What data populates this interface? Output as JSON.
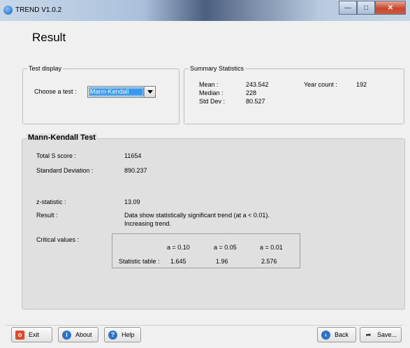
{
  "window": {
    "title": "TREND V1.0.2"
  },
  "page": {
    "title": "Result"
  },
  "test_display": {
    "legend": "Test display",
    "choose_label": "Choose a test :",
    "selected_test": "Mann-Kendall"
  },
  "summary": {
    "legend": "Summary Statistics",
    "mean_label": "Mean :",
    "mean_value": "243.542",
    "median_label": "Median :",
    "median_value": "228",
    "std_label": "Std Dev :",
    "std_value": "80.527",
    "year_count_label": "Year count :",
    "year_count_value": "192"
  },
  "mann_kendall": {
    "legend": "Mann-Kendall Test",
    "s_label": "Total S score :",
    "s_value": "11654",
    "sd_label": "Standard Deviation :",
    "sd_value": "890.237",
    "z_label": "z-statistic :",
    "z_value": "13.09",
    "result_label": "Result :",
    "result_line1": "Data show statistically significant trend (at a < 0.01).",
    "result_line2": "Increasing trend.",
    "critical_label": "Critical values :",
    "critical_headers": [
      "a = 0.10",
      "a = 0.05",
      "a = 0.01"
    ],
    "stat_table_label": "Statistic table :",
    "critical_values": [
      "1.645",
      "1.96",
      "2.576"
    ]
  },
  "buttons": {
    "exit": "Exit",
    "about": "About",
    "help": "Help",
    "back": "Back",
    "save": "Save..."
  },
  "icons": {
    "app": "app-icon",
    "exit": "exit-icon",
    "about": "info-icon",
    "help": "help-icon",
    "back": "back-arrow-icon",
    "save": "save-icon"
  }
}
